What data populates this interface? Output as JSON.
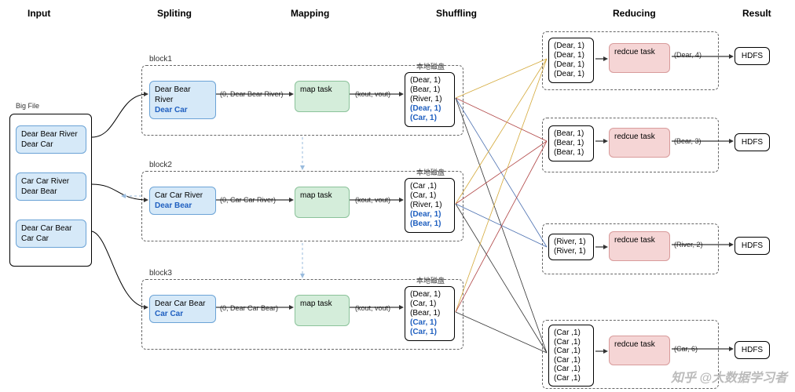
{
  "headers": {
    "input": "Input",
    "splitting": "Spliting",
    "mapping": "Mapping",
    "shuffling": "Shuffling",
    "reducing": "Reducing",
    "result": "Result"
  },
  "input": {
    "title": "Big File",
    "lines": [
      "Dear Bear River\nDear Car",
      "Car Car River\nDear Bear",
      "Dear Car Bear\nCar Car"
    ]
  },
  "blocks": [
    {
      "name": "block1",
      "split": [
        "Dear Bear River",
        "Dear Car"
      ],
      "map_in": "(0, Dear Bear River)",
      "map_task": "map task",
      "map_out_label": "(kout, vout)",
      "disk_label": "本地磁盘",
      "disk": [
        "(Dear, 1)",
        "(Bear, 1)",
        "(River, 1)",
        "(Dear, 1)",
        "(Car, 1)"
      ]
    },
    {
      "name": "block2",
      "split": [
        "Car Car River",
        "Dear Bear"
      ],
      "map_in": "(0, Car Car River)",
      "map_task": "map task",
      "map_out_label": "(kout, vout)",
      "disk_label": "本地磁盘",
      "disk": [
        "(Car ,1)",
        "(Car, 1)",
        "(River, 1)",
        "(Dear, 1)",
        "(Bear, 1)"
      ]
    },
    {
      "name": "block3",
      "split": [
        "Dear Car Bear",
        "Car Car"
      ],
      "map_in": "(0, Dear Car Bear)",
      "map_task": "map task",
      "map_out_label": "(kout, vout)",
      "disk_label": "本地磁盘",
      "disk": [
        "(Dear, 1)",
        "(Car, 1)",
        "(Bear, 1)",
        "(Car, 1)",
        "(Car, 1)"
      ]
    }
  ],
  "reducers": [
    {
      "shuffle": [
        "(Dear, 1)",
        "(Dear, 1)",
        "(Dear, 1)",
        "(Dear, 1)"
      ],
      "task": "redcue task",
      "out": "(Dear, 4)",
      "result": "HDFS"
    },
    {
      "shuffle": [
        "(Bear, 1)",
        "(Bear, 1)",
        "(Bear, 1)"
      ],
      "task": "redcue task",
      "out": "(Bear, 3)",
      "result": "HDFS"
    },
    {
      "shuffle": [
        "(River, 1)",
        "(River, 1)"
      ],
      "task": "redcue task",
      "out": "(River, 2)",
      "result": "HDFS"
    },
    {
      "shuffle": [
        "(Car ,1)",
        "(Car ,1)",
        "(Car ,1)",
        "(Car ,1)",
        "(Car ,1)",
        "(Car ,1)"
      ],
      "task": "redcue task",
      "out": "(Car, 6)",
      "result": "HDFS"
    }
  ],
  "watermark": "知乎 @大数据学习者"
}
